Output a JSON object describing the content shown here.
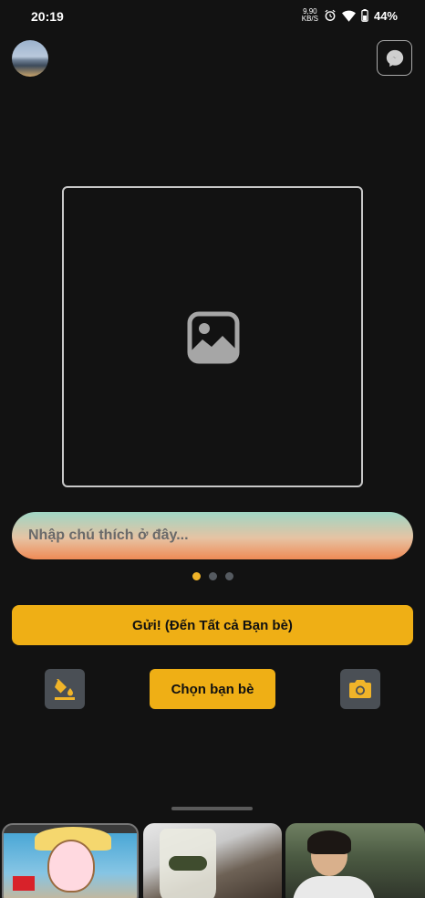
{
  "status_bar": {
    "time": "20:19",
    "speed_top": "9,90",
    "speed_unit": "KB/S",
    "battery": "44%"
  },
  "caption": {
    "placeholder": "Nhập chú thích ở đây..."
  },
  "pager": {
    "current": 1,
    "total": 3
  },
  "actions": {
    "send_label": "Gửi! (Đến Tất cả Bạn bè)",
    "choose_friends_label": "Chọn bạn bè"
  },
  "icons": {
    "avatar": "avatar",
    "messenger": "messenger-icon",
    "image_placeholder": "image-icon",
    "fill": "paint-bucket-icon",
    "camera": "camera-icon"
  },
  "colors": {
    "accent": "#efaf15",
    "background": "#121212",
    "tool_button": "#4a4f55"
  }
}
